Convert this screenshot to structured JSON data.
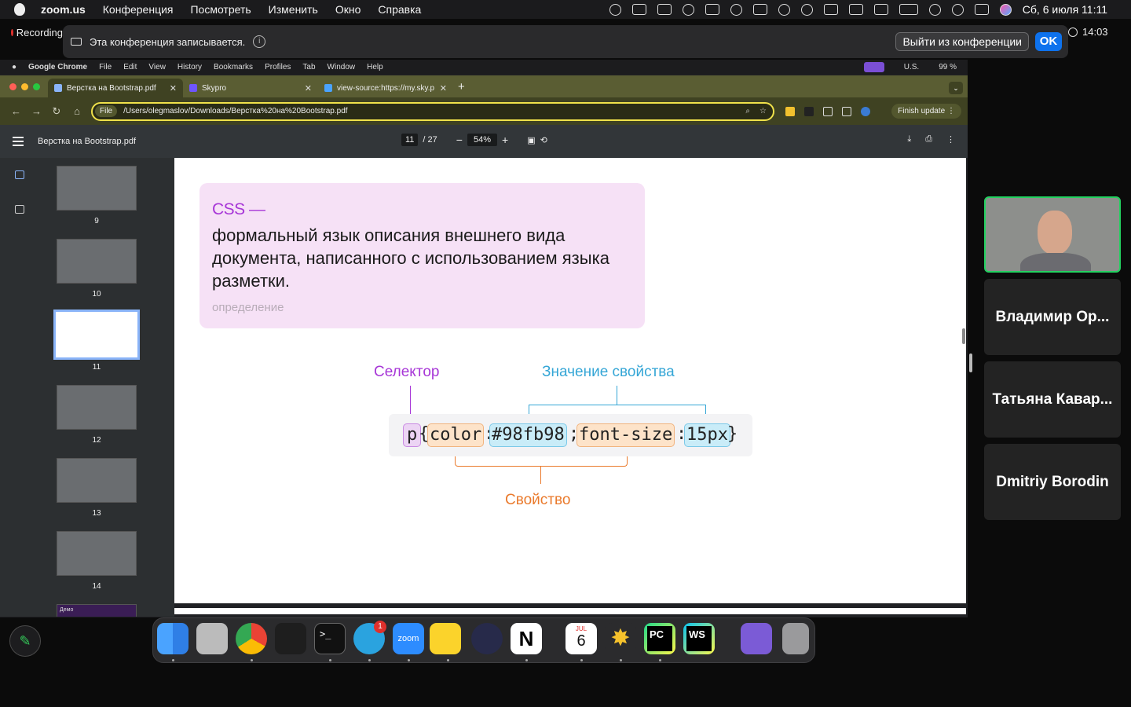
{
  "menubar": {
    "app": "zoom.us",
    "items": [
      "Конференция",
      "Посмотреть",
      "Изменить",
      "Окно",
      "Справка"
    ],
    "datetime": "Сб, 6 июля  11:11"
  },
  "recording": {
    "left_label": "Recording",
    "text": "Эта конференция записывается.",
    "leave_button": "Выйти из конференции",
    "ok_button": "OK",
    "timer": "14:03"
  },
  "shared_menubar": {
    "app": "Google Chrome",
    "items": [
      "File",
      "Edit",
      "View",
      "History",
      "Bookmarks",
      "Profiles",
      "Tab",
      "Window",
      "Help"
    ],
    "keyboard": "U.S.",
    "battery": "99 %"
  },
  "tabs": [
    {
      "title": "Верстка на Bootstrap.pdf",
      "color": "#8ab4f8"
    },
    {
      "title": "Skypro",
      "color": "#6e55ff"
    },
    {
      "title": "view-source:https://my.sky.p",
      "color": "#4aa3ff"
    }
  ],
  "address": {
    "scheme": "File",
    "url": "/Users/olegmaslov/Downloads/Верстка%20на%20Bootstrap.pdf",
    "finish_update": "Finish update"
  },
  "pdf": {
    "filename": "Верстка на Bootstrap.pdf",
    "current_page": "11",
    "total_pages": "/ 27",
    "zoom": "54%",
    "thumbnails": [
      "9",
      "10",
      "11",
      "12",
      "13",
      "14"
    ],
    "selected_page": "11",
    "next_thumb_label": "Демо"
  },
  "slide": {
    "term": "CSS —",
    "definition": "формальный язык описания внешнего вида документа, написанного с использованием языка разметки.",
    "caption": "определение",
    "label_selector": "Селектор",
    "label_value": "Значение свойства",
    "label_property": "Свойство",
    "code_tokens": [
      "p",
      "{",
      "color",
      ":",
      "#98fb98",
      ";",
      "font-size",
      ":",
      "15px",
      "}"
    ],
    "colors": {
      "selector": "#a736d7",
      "value": "#35a6d6",
      "property": "#ea7a2c"
    }
  },
  "participants": [
    "Владимир Ор...",
    "Татьяна Кавар...",
    "Dmitriy Borodin"
  ],
  "dock": {
    "apps": [
      "finder-icon",
      "launchpad-icon",
      "chrome-icon",
      "figma-icon",
      "terminal-icon",
      "telegram-icon",
      "zoom-icon",
      "miro-icon",
      "obs-icon",
      "notion-icon",
      "calendar-icon",
      "spark-icon",
      "pycharm-icon",
      "webstorm-icon",
      "downloads-folder-icon",
      "trash-icon"
    ],
    "telegram_badge": "1",
    "zoom_label": "zoom",
    "calendar_month": "JUL",
    "calendar_day": "6",
    "pycharm_label": "PC",
    "webstorm_label": "WS"
  }
}
